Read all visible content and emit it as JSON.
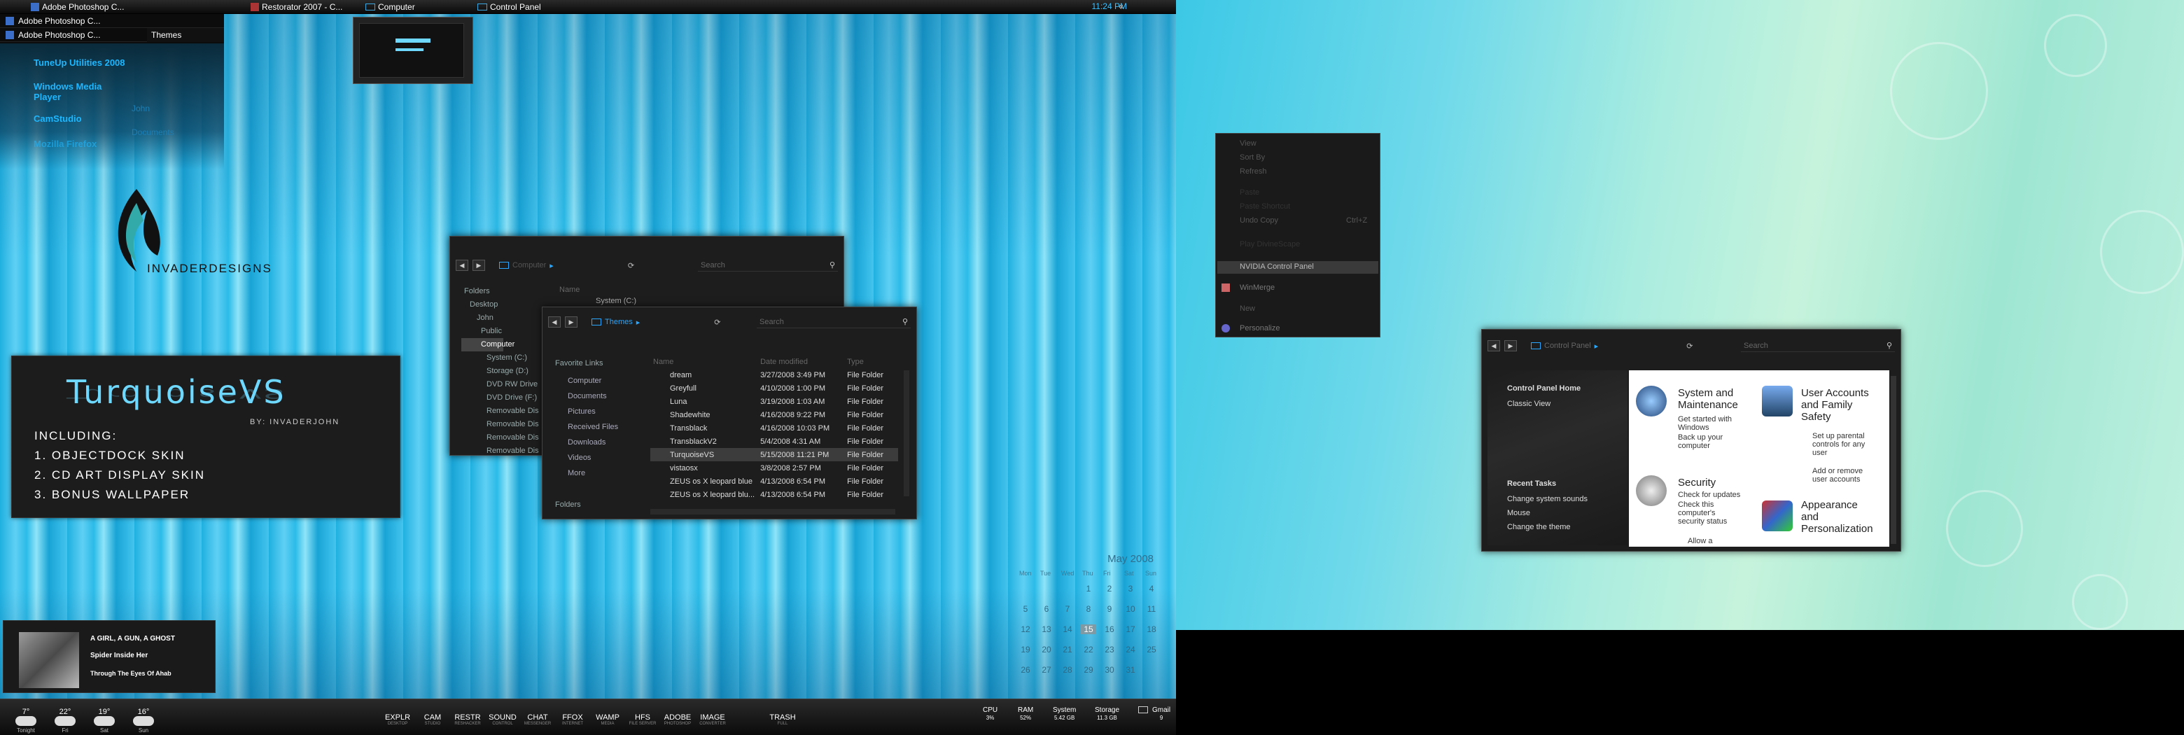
{
  "taskbar_top": {
    "buttons": [
      "Adobe Photoshop C...",
      "Restorator 2007 - C...",
      "Computer",
      "Control Panel"
    ],
    "clock": "11:24 PM",
    "collapse": "«"
  },
  "stack": {
    "items": [
      "Adobe Photoshop C...",
      "Adobe Photoshop C..."
    ],
    "themes_tab": "Themes"
  },
  "dock_panel": {
    "items": [
      "TuneUp Utilities 2008",
      "Windows Media Player",
      "CamStudio",
      "Mozilla Firefox"
    ],
    "side": [
      "John",
      "Documents"
    ]
  },
  "logo": {
    "text": "INVADERDESIGNS"
  },
  "card": {
    "title": "TurquoiseVS",
    "by": "BY: INVADERJOHN",
    "including": "INCLUDING:",
    "items": [
      "1. OBJECTDOCK SKIN",
      "2. CD ART DISPLAY SKIN",
      "3. BONUS WALLPAPER"
    ]
  },
  "music": {
    "album": "A GIRL, A GUN, A GHOST",
    "track": "Spider Inside Her",
    "artist": "Through The Eyes Of Ahab"
  },
  "explorer_computer": {
    "path": "Computer",
    "search": "Search",
    "folders_label": "Folders",
    "tree": [
      "Desktop",
      "John",
      "Public",
      "Computer",
      "System (C:)",
      "Storage (D:)",
      "DVD RW Drive",
      "DVD Drive (F:)",
      "Removable Dis",
      "Removable Dis",
      "Removable Dis",
      "Removable Dis"
    ],
    "col_name": "Name",
    "first_item": "System (C:)"
  },
  "explorer_themes": {
    "path": "Themes",
    "search": "Search",
    "favorites_label": "Favorite Links",
    "favorites": [
      "Computer",
      "Documents",
      "Pictures",
      "Received Files",
      "Downloads",
      "Videos",
      "More"
    ],
    "folders_label": "Folders",
    "columns": [
      "Name",
      "Date modified",
      "Type"
    ],
    "rows": [
      {
        "name": "dream",
        "date": "3/27/2008 3:49 PM",
        "type": "File Folder"
      },
      {
        "name": "Greyfull",
        "date": "4/10/2008 1:00 PM",
        "type": "File Folder"
      },
      {
        "name": "Luna",
        "date": "3/19/2008 1:03 AM",
        "type": "File Folder"
      },
      {
        "name": "Shadewhite",
        "date": "4/16/2008 9:22 PM",
        "type": "File Folder"
      },
      {
        "name": "Transblack",
        "date": "4/16/2008 10:03 PM",
        "type": "File Folder"
      },
      {
        "name": "TransblackV2",
        "date": "5/4/2008 4:31 AM",
        "type": "File Folder"
      },
      {
        "name": "TurquoiseVS",
        "date": "5/15/2008 11:21 PM",
        "type": "File Folder"
      },
      {
        "name": "vistaosx",
        "date": "3/8/2008 2:57 PM",
        "type": "File Folder"
      },
      {
        "name": "ZEUS os X  leopard  blue",
        "date": "4/13/2008 6:54 PM",
        "type": "File Folder"
      },
      {
        "name": "ZEUS os X  leopard  blu...",
        "date": "4/13/2008 6:54 PM",
        "type": "File Folder"
      }
    ]
  },
  "context_menu": {
    "items": [
      "View",
      "Sort By",
      "Refresh",
      "Paste",
      "Paste Shortcut",
      "Undo Copy",
      "Play DivineScape",
      "NVIDIA Control Panel",
      "WinMerge",
      "New",
      "Personalize"
    ],
    "undo_shortcut": "Ctrl+Z"
  },
  "control_panel": {
    "path": "Control Panel",
    "search": "Search",
    "links": [
      "Control Panel Home",
      "Classic View"
    ],
    "recent_label": "Recent Tasks",
    "recent": [
      "Change system sounds",
      "Mouse",
      "Change the theme"
    ],
    "categories": [
      {
        "title": "System and Maintenance",
        "subs": [
          "Get started with Windows",
          "Back up your computer"
        ]
      },
      {
        "title": "Security",
        "subs": [
          "Check for updates",
          "Check this computer's security status",
          "Allow a"
        ]
      },
      {
        "title": "User Accounts and Family Safety",
        "subs": [
          "Set up parental controls for any user",
          "Add or remove user accounts"
        ]
      },
      {
        "title": "Appearance and Personalization",
        "subs": []
      }
    ]
  },
  "calendar": {
    "month": "May 2008",
    "days": [
      "Mon",
      "Tue",
      "Wed",
      "Thu",
      "Fri",
      "Sat",
      "Sun"
    ],
    "weeks": [
      [
        "",
        "",
        "",
        "1",
        "2",
        "3",
        "4"
      ],
      [
        "5",
        "6",
        "7",
        "8",
        "9",
        "10",
        "11"
      ],
      [
        "12",
        "13",
        "14",
        "15",
        "16",
        "17",
        "18"
      ],
      [
        "19",
        "20",
        "21",
        "22",
        "23",
        "24",
        "25"
      ],
      [
        "26",
        "27",
        "28",
        "29",
        "30",
        "31",
        ""
      ]
    ],
    "today": "15"
  },
  "weather": [
    {
      "temp": "7°",
      "label": "Tonight"
    },
    {
      "temp": "22°",
      "label": "Fri"
    },
    {
      "temp": "19°",
      "label": "Sat"
    },
    {
      "temp": "16°",
      "label": "Sun"
    }
  ],
  "dock": [
    {
      "label": "EXPLR",
      "sub": "DESKTOP"
    },
    {
      "label": "CAM",
      "sub": "STUDIO"
    },
    {
      "label": "RESTR",
      "sub": "RESHACKER"
    },
    {
      "label": "SOUND",
      "sub": "CONTROL"
    },
    {
      "label": "CHAT",
      "sub": "MESSENGER"
    },
    {
      "label": "FFOX",
      "sub": "INTERNET"
    },
    {
      "label": "WAMP",
      "sub": "MEDIA"
    },
    {
      "label": "HFS",
      "sub": "FILE SERVER"
    },
    {
      "label": "ADOBE",
      "sub": "PHOTOSHOP"
    },
    {
      "label": "IMAGE",
      "sub": "CONVERTER"
    },
    {
      "label": "TRASH",
      "sub": "FULL"
    }
  ],
  "stats": [
    {
      "label": "CPU",
      "value": "3%"
    },
    {
      "label": "RAM",
      "value": "52%"
    },
    {
      "label": "System",
      "value": "5.42 GB"
    },
    {
      "label": "Storage",
      "value": "11.3 GB"
    },
    {
      "label": "Gmail",
      "value": "9"
    }
  ],
  "colors": {
    "accent": "#2aa7ff",
    "window": "#1d1d1d",
    "desktop": "#2bbbe8"
  }
}
